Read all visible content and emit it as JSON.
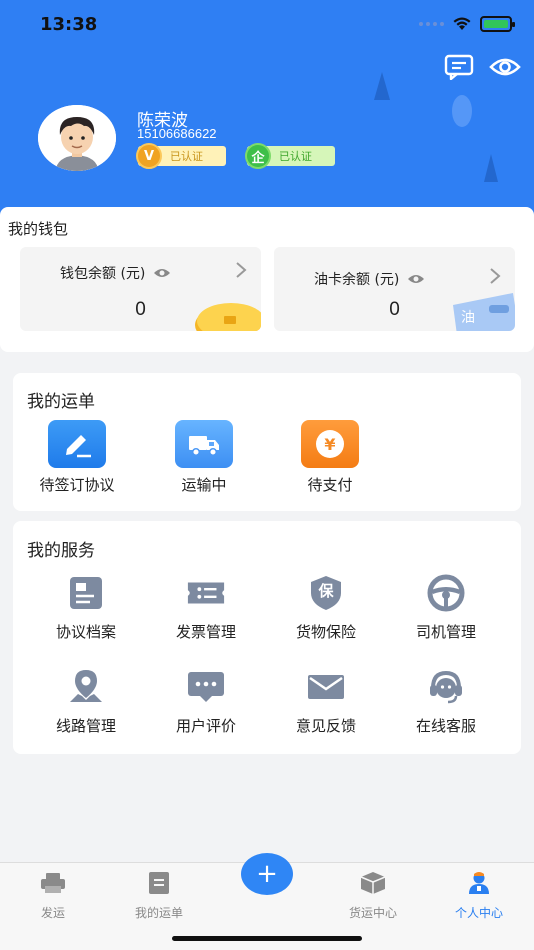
{
  "status_bar": {
    "time": "13:38"
  },
  "colors": {
    "header_bg": "#2f7ff3",
    "accent": "#2a7ff0",
    "orange": "#f58a24",
    "icon_gray": "#7d8aa0"
  },
  "header": {
    "icons": [
      "message-icon",
      "eye-icon"
    ],
    "user": {
      "name": "陈荣波",
      "phone": "15106686622",
      "badges": [
        {
          "icon_text": "V",
          "label": "已认证"
        },
        {
          "icon_text": "企",
          "label": "已认证"
        }
      ]
    }
  },
  "wallet": {
    "title": "我的钱包",
    "cards": [
      {
        "label": "钱包余额 (元)",
        "value": "0"
      },
      {
        "label": "油卡余额 (元)",
        "value": "0",
        "card_text": "油"
      }
    ]
  },
  "orders": {
    "title": "我的运单",
    "items": [
      {
        "label": "待签订协议",
        "icon": "sign-pen-icon"
      },
      {
        "label": "运输中",
        "icon": "truck-icon"
      },
      {
        "label": "待支付",
        "icon": "yen-icon",
        "glyph": "¥"
      }
    ]
  },
  "services": {
    "title": "我的服务",
    "items": [
      {
        "label": "协议档案",
        "icon": "document-icon"
      },
      {
        "label": "发票管理",
        "icon": "invoice-icon"
      },
      {
        "label": "货物保险",
        "icon": "insurance-shield-icon",
        "glyph": "保"
      },
      {
        "label": "司机管理",
        "icon": "steering-wheel-icon"
      },
      {
        "label": "线路管理",
        "icon": "location-pin-icon"
      },
      {
        "label": "用户评价",
        "icon": "comment-icon"
      },
      {
        "label": "意见反馈",
        "icon": "mail-icon"
      },
      {
        "label": "在线客服",
        "icon": "headset-icon"
      }
    ]
  },
  "tabbar": {
    "tabs": [
      {
        "label": "发运",
        "icon": "printer-icon"
      },
      {
        "label": "我的运单",
        "icon": "list-icon"
      },
      {
        "label": "货运中心",
        "icon": "box-icon"
      },
      {
        "label": "个人中心",
        "icon": "person-icon",
        "active": true
      }
    ],
    "center_button": "+"
  }
}
